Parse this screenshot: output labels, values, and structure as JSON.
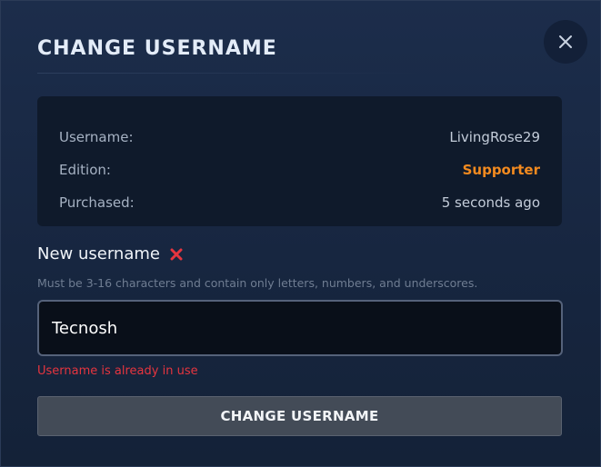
{
  "dialog": {
    "title": "CHANGE USERNAME",
    "close_icon": "close-icon"
  },
  "account_info": {
    "rows": [
      {
        "label": "Username:",
        "value": "LivingRose29"
      },
      {
        "label": "Edition:",
        "value": "Supporter"
      },
      {
        "label": "Purchased:",
        "value": "5 seconds ago"
      }
    ]
  },
  "new_username": {
    "label": "New username",
    "status_icon": "invalid-x-icon",
    "hint": "Must be 3-16 characters and contain only letters, numbers, and underscores.",
    "value": "Tecnosh",
    "error": "Username is already in use"
  },
  "submit": {
    "label": "CHANGE USERNAME"
  },
  "colors": {
    "accent_orange": "#f28a1f",
    "error_red": "#e6353f"
  }
}
